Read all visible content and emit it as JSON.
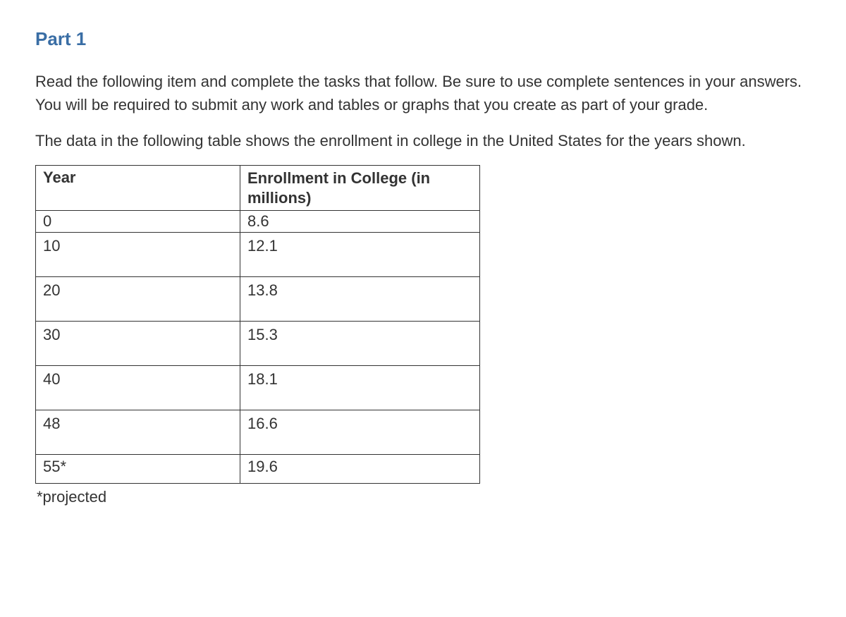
{
  "heading": "Part 1",
  "paragraph1": "Read the following item and complete the tasks that follow. Be sure to use complete sentences in your answers. You will be required to submit any work and tables or graphs that you create as part of your grade.",
  "paragraph2": "The data in the following table shows the enrollment in college in the United States for the years shown.",
  "table": {
    "headers": {
      "year": "Year",
      "enrollment": "Enrollment in College (in millions)"
    },
    "rows": [
      {
        "year": "0",
        "enrollment": "8.6"
      },
      {
        "year": "10",
        "enrollment": "12.1"
      },
      {
        "year": "20",
        "enrollment": "13.8"
      },
      {
        "year": "30",
        "enrollment": "15.3"
      },
      {
        "year": "40",
        "enrollment": "18.1"
      },
      {
        "year": "48",
        "enrollment": "16.6"
      },
      {
        "year": "55*",
        "enrollment": "19.6"
      }
    ]
  },
  "footnote": "*projected",
  "chart_data": {
    "type": "table",
    "title": "Enrollment in College (in millions)",
    "categories": [
      "0",
      "10",
      "20",
      "30",
      "40",
      "48",
      "55*"
    ],
    "values": [
      8.6,
      12.1,
      13.8,
      15.3,
      18.1,
      16.6,
      19.6
    ],
    "xlabel": "Year",
    "ylabel": "Enrollment in College (in millions)",
    "note": "55* is projected"
  }
}
